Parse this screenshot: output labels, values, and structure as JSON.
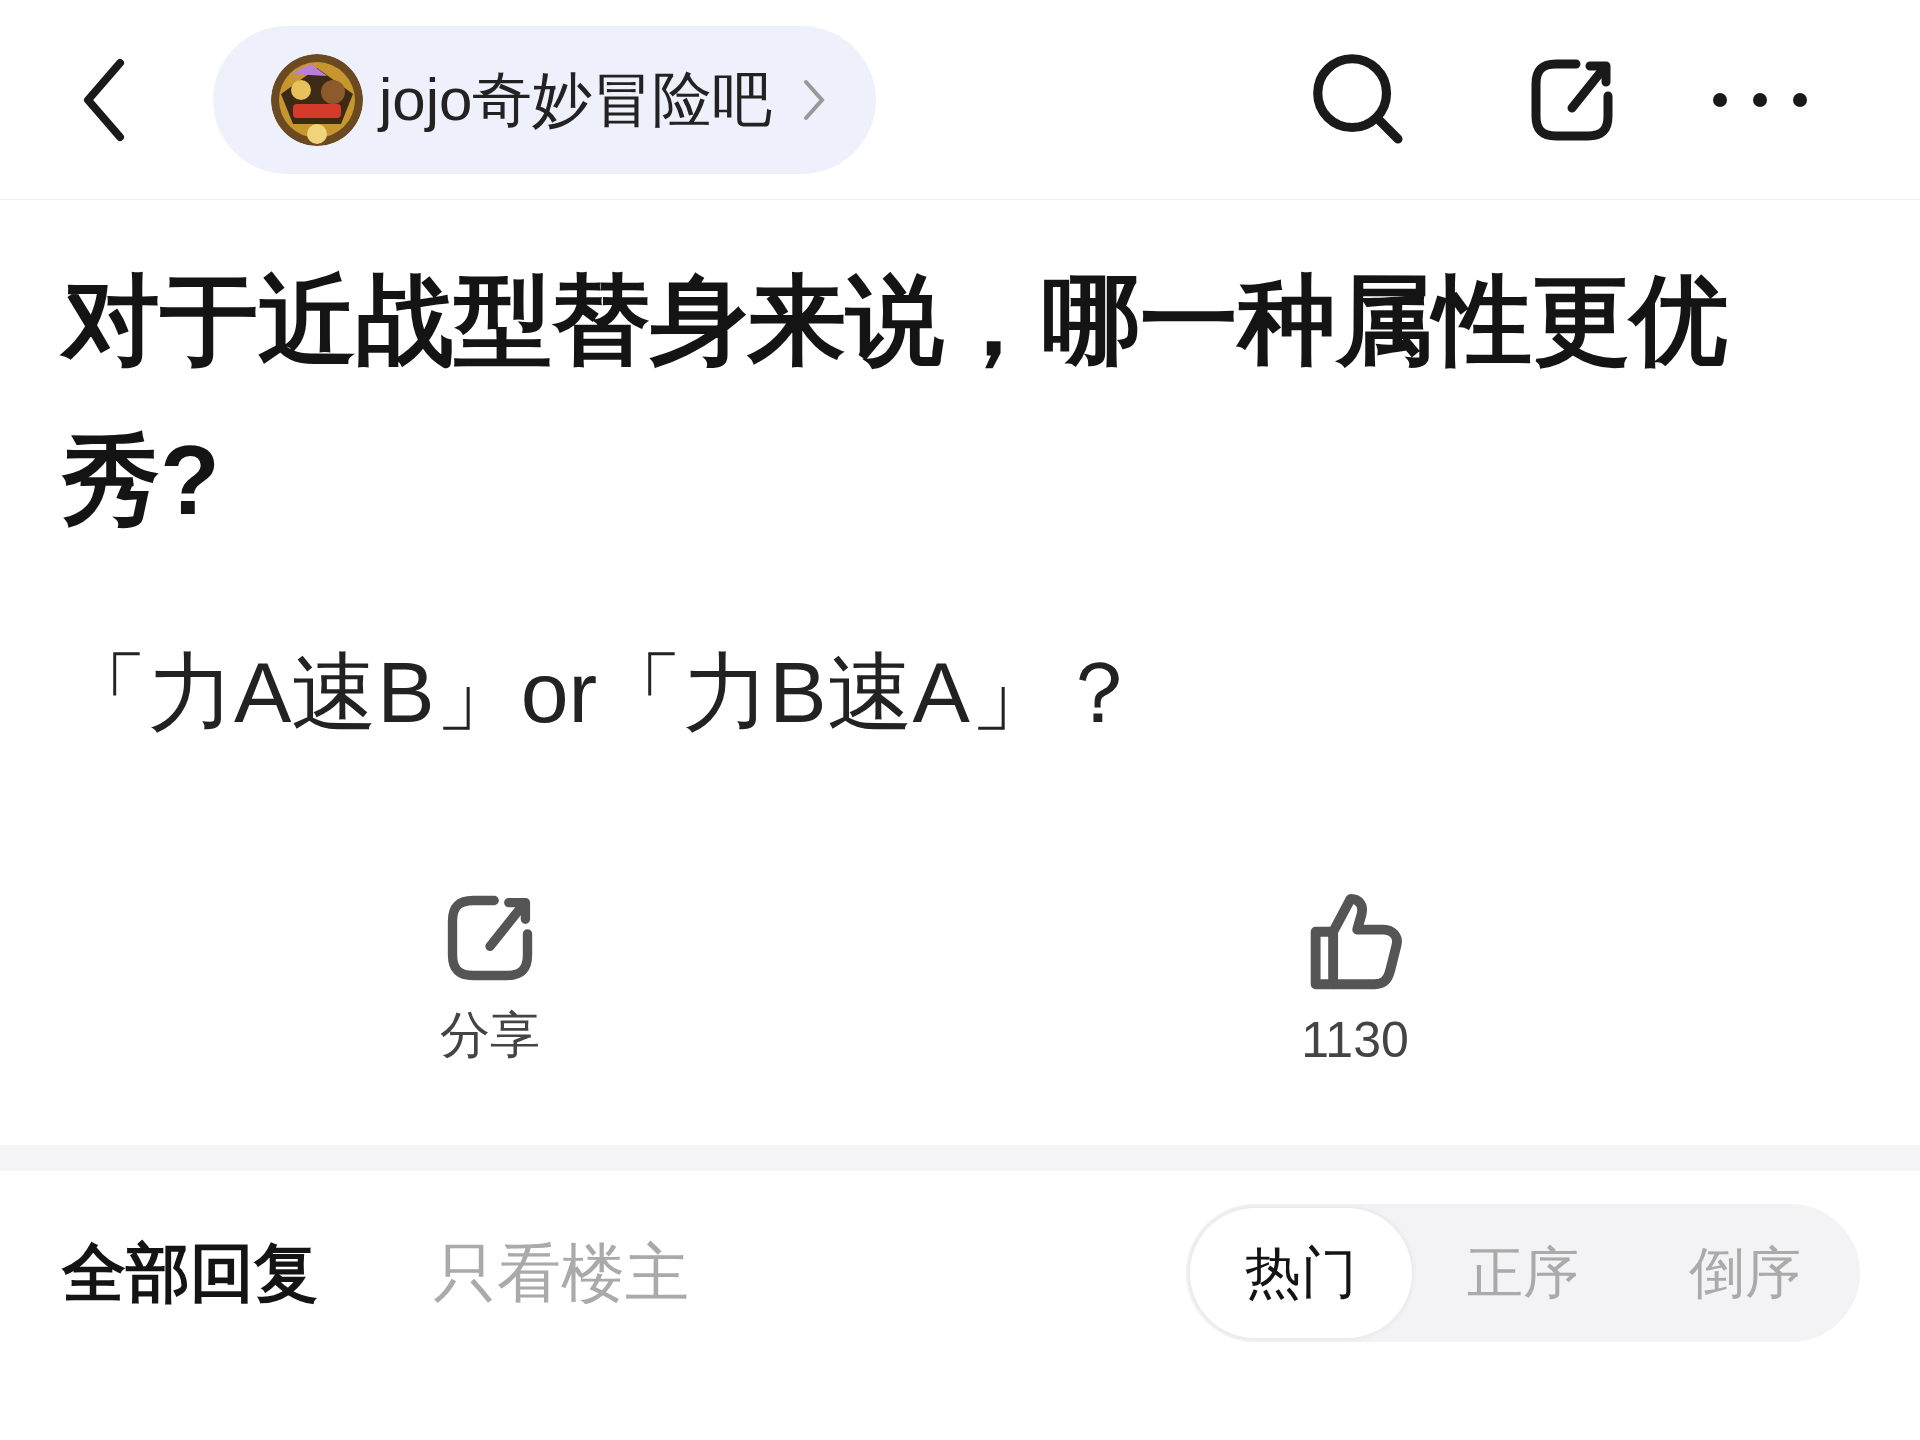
{
  "nav": {
    "forum_name": "jojo奇妙冒险吧"
  },
  "post": {
    "title": "对于近战型替身来说，哪一种属性更优秀?",
    "body": "「力A速B」or「力B速A」？"
  },
  "actions": [
    {
      "kind": "share",
      "label": "分享"
    },
    {
      "kind": "like",
      "label": "1130"
    }
  ],
  "replies": {
    "filters": [
      {
        "label": "全部回复",
        "selected": true
      },
      {
        "label": "只看楼主",
        "selected": false
      }
    ],
    "sort": [
      {
        "label": "热门",
        "selected": true
      },
      {
        "label": "正序",
        "selected": false
      },
      {
        "label": "倒序",
        "selected": false
      }
    ]
  }
}
